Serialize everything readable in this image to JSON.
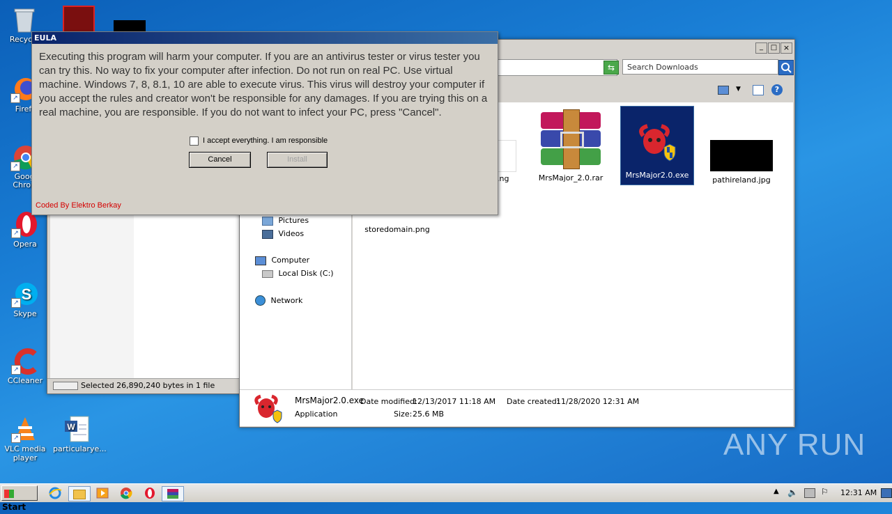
{
  "desktop": {
    "icons": [
      {
        "label": "Recycle",
        "icon": "recycle-bin-icon"
      },
      {
        "label": "Firefox",
        "icon": "firefox-icon"
      },
      {
        "label": "Google Chrome",
        "icon": "chrome-icon"
      },
      {
        "label": "Opera",
        "icon": "opera-icon"
      },
      {
        "label": "Skype",
        "icon": "skype-icon"
      },
      {
        "label": "CCleaner",
        "icon": "ccleaner-icon"
      },
      {
        "label": "VLC media player",
        "icon": "vlc-icon"
      },
      {
        "label": "particularye...",
        "icon": "word-doc-icon"
      }
    ],
    "watermark": "ANY RUN"
  },
  "eula": {
    "title": "EULA",
    "message": "Executing this program will harm your computer. If you are an antivirus tester or virus tester you can try this. No way to fix your computer after infection. Do not run on real PC. Use virtual machine. Windows 7, 8, 8.1, 10 are able to execute virus. This virus will destroy your computer if you accept the rules and creator won't be responsible for any damages. If you are trying this on a real machine, you are responsible. If you do not want to infect your PC, press \"Cancel\".",
    "checkbox_label": "I accept everything. I am responsible",
    "checkbox_checked": false,
    "cancel_label": "Cancel",
    "install_label": "Install",
    "credit": "Coded By Elektro Berkay"
  },
  "back_window": {
    "status": "Selected 26,890,240 bytes in 1 file"
  },
  "explorer": {
    "search_placeholder": "Search Downloads",
    "nav": [
      {
        "label": "Pictures",
        "icon": "pictures-folder-icon"
      },
      {
        "label": "Videos",
        "icon": "videos-folder-icon"
      },
      {
        "label": "Computer",
        "icon": "computer-icon"
      },
      {
        "label": "Local Disk (C:)",
        "icon": "local-disk-icon"
      },
      {
        "label": "Network",
        "icon": "network-icon"
      }
    ],
    "files": [
      {
        "name": "storedomain.png",
        "icon": "image-file-icon"
      },
      {
        "name": "...ng",
        "icon": "image-file-icon"
      },
      {
        "name": "MrsMajor_2.0.rar",
        "icon": "winrar-archive-icon"
      },
      {
        "name": "MrsMajor2.0.exe",
        "icon": "ram-skull-shield-icon",
        "selected": true
      },
      {
        "name": "pathireland.jpg",
        "icon": "image-thumbnail-icon"
      }
    ],
    "details": {
      "name": "MrsMajor2.0.exe",
      "type": "Application",
      "modified_label": "Date modified:",
      "modified": "12/13/2017 11:18 AM",
      "created_label": "Date created:",
      "created": "11/28/2020 12:31 AM",
      "size_label": "Size:",
      "size": "25.6 MB"
    }
  },
  "taskbar": {
    "start_label": "Start",
    "clock": "12:31 AM"
  },
  "colors": {
    "desktop_blue": "#1a7fd6",
    "selection": "#0a246a",
    "credit_red": "#d40000"
  }
}
